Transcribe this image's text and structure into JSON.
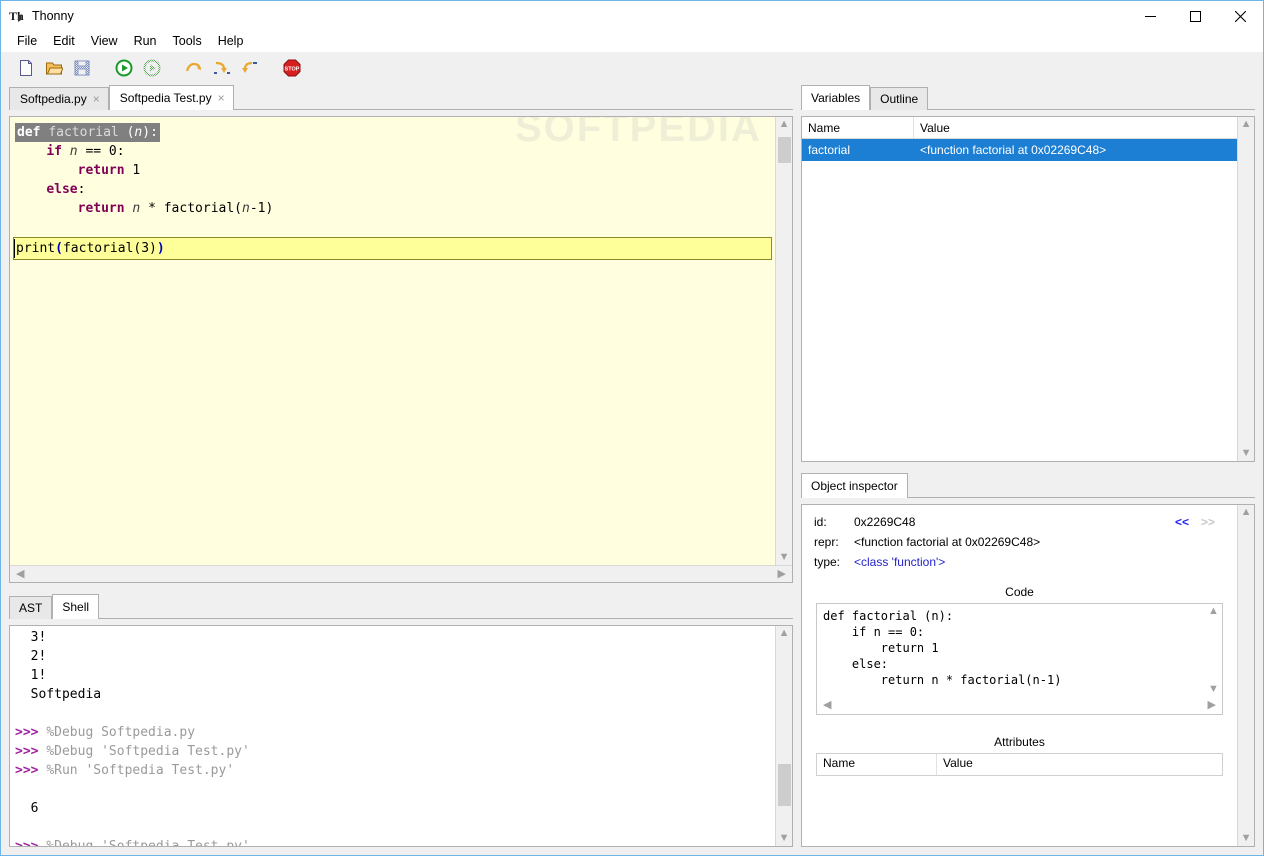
{
  "window": {
    "title": "Thonny",
    "icon": "thonny-logo-icon",
    "minimize_label": "Minimize",
    "maximize_label": "Maximize",
    "close_label": "Close"
  },
  "menubar": {
    "items": [
      {
        "label": "File"
      },
      {
        "label": "Edit"
      },
      {
        "label": "View"
      },
      {
        "label": "Run"
      },
      {
        "label": "Tools"
      },
      {
        "label": "Help"
      }
    ]
  },
  "toolbar": {
    "buttons": [
      {
        "name": "new-file-icon",
        "title": "New"
      },
      {
        "name": "open-file-icon",
        "title": "Load"
      },
      {
        "name": "save-file-icon",
        "title": "Save"
      },
      {
        "name": "run-icon",
        "title": "Run current script"
      },
      {
        "name": "debug-icon",
        "title": "Debug current script"
      },
      {
        "name": "step-over-icon",
        "title": "Step over"
      },
      {
        "name": "step-into-icon",
        "title": "Step into"
      },
      {
        "name": "step-out-icon",
        "title": "Step out"
      },
      {
        "name": "stop-icon",
        "title": "Stop"
      }
    ]
  },
  "editor": {
    "tabs": [
      {
        "label": "Softpedia.py",
        "active": false,
        "close": "×"
      },
      {
        "label": "Softpedia Test.py",
        "active": true,
        "close": "×"
      }
    ],
    "watermark": "SOFTPEDIA",
    "code": {
      "def_keyword": "def",
      "def_name": "factorial",
      "def_open": " (",
      "def_param": "n",
      "def_close": "):",
      "line_if_kw": "if",
      "line_if_var": "n",
      "line_if_rest": "== 0:",
      "line_return1_kw": "return",
      "line_return1_rest": "1",
      "line_else_kw": "else",
      "line_else_rest": ":",
      "line_return2_kw": "return",
      "line_return2_var": "n",
      "line_return2_mid": "* factorial(",
      "line_return2_var2": "n",
      "line_return2_end": "-1)",
      "print_call": "print",
      "print_open": "(",
      "print_inner": "factorial(3)",
      "print_close": ")"
    }
  },
  "shell": {
    "tabs": [
      {
        "label": "AST",
        "active": false
      },
      {
        "label": "Shell",
        "active": true
      }
    ],
    "lines": [
      {
        "prompt": "",
        "text": "3!",
        "kind": "output"
      },
      {
        "prompt": "",
        "text": "2!",
        "kind": "output"
      },
      {
        "prompt": "",
        "text": "1!",
        "kind": "output"
      },
      {
        "prompt": "",
        "text": "Softpedia",
        "kind": "output"
      },
      {
        "prompt": "",
        "text": "",
        "kind": "blank"
      },
      {
        "prompt": ">>>",
        "text": "%Debug Softpedia.py",
        "kind": "command"
      },
      {
        "prompt": ">>>",
        "text": "%Debug 'Softpedia Test.py'",
        "kind": "command"
      },
      {
        "prompt": ">>>",
        "text": "%Run 'Softpedia Test.py'",
        "kind": "command"
      },
      {
        "prompt": "",
        "text": "",
        "kind": "blank"
      },
      {
        "prompt": "",
        "text": "6",
        "kind": "output"
      },
      {
        "prompt": "",
        "text": "",
        "kind": "blank"
      },
      {
        "prompt": ">>>",
        "text": "%Debug 'Softpedia Test.py'",
        "kind": "command"
      }
    ]
  },
  "variables": {
    "tabs": [
      {
        "label": "Variables",
        "active": true
      },
      {
        "label": "Outline",
        "active": false
      }
    ],
    "columns": [
      "Name",
      "Value"
    ],
    "rows": [
      {
        "name": "factorial",
        "value": "<function factorial at 0x02269C48>",
        "selected": true
      }
    ]
  },
  "object_inspector": {
    "tab_label": "Object inspector",
    "fields": [
      {
        "label": "id:",
        "value": "0x2269C48",
        "link": false
      },
      {
        "label": "repr:",
        "value": "<function factorial at 0x02269C48>",
        "link": false
      },
      {
        "label": "type:",
        "value": "<class 'function'>",
        "link": true
      }
    ],
    "nav_prev": "<<",
    "nav_next": ">>",
    "code_title": "Code",
    "code_text": "def factorial (n):\n    if n == 0:\n        return 1\n    else:\n        return n * factorial(n-1)",
    "attributes_title": "Attributes",
    "attributes_columns": [
      "Name",
      "Value"
    ],
    "attributes_rows": []
  },
  "colors": {
    "selection_blue": "#1d7fd4",
    "editor_background": "#ffffe0",
    "current_line": "#ffff99",
    "keyword": "#7f0055",
    "prompt_magenta": "#a020a0",
    "command_gray": "#9a9a9a",
    "link_blue": "#2222cc",
    "window_border": "#6fb5e8"
  }
}
